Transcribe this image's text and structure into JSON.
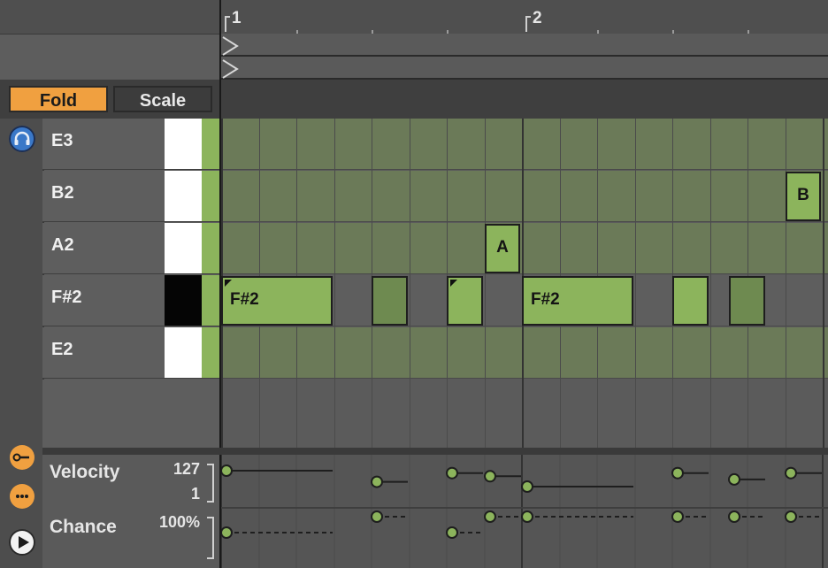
{
  "timeline": {
    "bar_markers": [
      "1",
      "2"
    ]
  },
  "toolbar": {
    "fold_label": "Fold",
    "scale_label": "Scale"
  },
  "rows": [
    {
      "key": "E3",
      "label": "E3",
      "key_color": "white"
    },
    {
      "key": "B2",
      "label": "B2",
      "key_color": "white"
    },
    {
      "key": "A2",
      "label": "A2",
      "key_color": "white"
    },
    {
      "key": "F#2",
      "label": "F#2",
      "key_color": "black"
    },
    {
      "key": "E2",
      "label": "E2",
      "key_color": "white"
    }
  ],
  "notes": [
    {
      "row": "F#2",
      "start": 0.0,
      "length": 0.75,
      "label": "F#2",
      "selected_corner": true
    },
    {
      "row": "F#2",
      "start": 1.0,
      "length": 0.25,
      "label": "",
      "selected_corner": false
    },
    {
      "row": "F#2",
      "start": 1.5,
      "length": 0.25,
      "label": "",
      "selected_corner": true
    },
    {
      "row": "A2",
      "start": 1.75,
      "length": 0.25,
      "label": "A",
      "selected_corner": false
    },
    {
      "row": "F#2",
      "start": 2.0,
      "length": 0.75,
      "label": "F#2",
      "selected_corner": false
    },
    {
      "row": "F#2",
      "start": 3.0,
      "length": 0.25,
      "label": "",
      "selected_corner": false
    },
    {
      "row": "F#2",
      "start": 3.375,
      "length": 0.25,
      "label": "",
      "selected_corner": false
    },
    {
      "row": "B2",
      "start": 3.75,
      "length": 0.25,
      "label": "B",
      "selected_corner": false
    }
  ],
  "velocity_lane": {
    "title": "Velocity",
    "max_label": "127",
    "min_label": "1",
    "levels": [
      1.0,
      0.3,
      0.85,
      0.65,
      0.0,
      0.85,
      0.45,
      0.85
    ]
  },
  "chance_lane": {
    "title": "Chance",
    "max_label": "100%",
    "levels": [
      0.0,
      1.0,
      0.0,
      1.0,
      1.0,
      1.0,
      1.0,
      1.0
    ]
  },
  "colors": {
    "accent_orange": "#f0a040",
    "note_green": "#8cb45c",
    "note_green_dark": "#6e8a50",
    "lane_green_bg": "#6b7a58",
    "headphones_blue": "#3a78c8"
  },
  "icons": {
    "preview": "headphones-icon",
    "velocity_tool": "key-icon",
    "chance_tool": "dice-icon",
    "play": "play-icon",
    "loop_start": "loop-start-flag-icon",
    "loop_end": "loop-end-flag-icon"
  }
}
